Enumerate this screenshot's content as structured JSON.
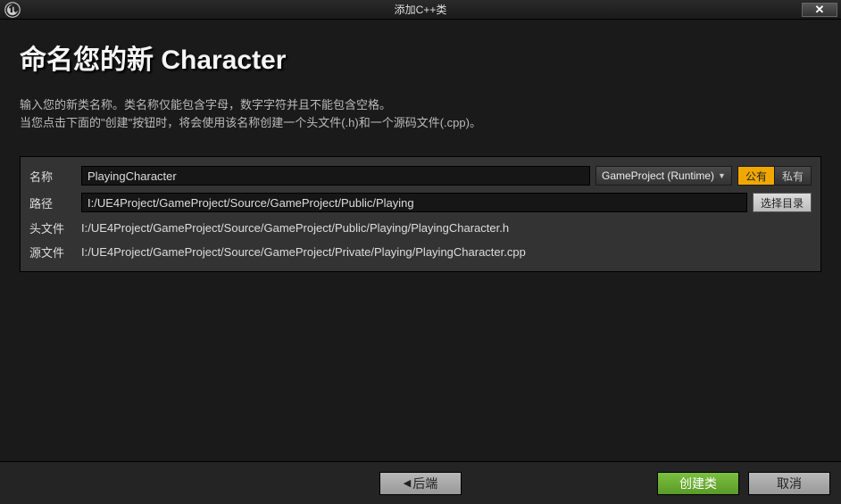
{
  "titlebar": {
    "title": "添加C++类"
  },
  "heading": {
    "prefix": "命名您的新 ",
    "class_name": "Character"
  },
  "description": {
    "line1": "输入您的新类名称。类名称仅能包含字母，数字字符并且不能包含空格。",
    "line2": "当您点击下面的\"创建\"按钮时，将会使用该名称创建一个头文件(.h)和一个源码文件(.cpp)。"
  },
  "form": {
    "name_label": "名称",
    "name_value": "PlayingCharacter",
    "module_dropdown": "GameProject (Runtime)",
    "public_label": "公有",
    "private_label": "私有",
    "path_label": "路径",
    "path_value": "I:/UE4Project/GameProject/Source/GameProject/Public/Playing",
    "browse_label": "选择目录",
    "header_label": "头文件",
    "header_value": "I:/UE4Project/GameProject/Source/GameProject/Public/Playing/PlayingCharacter.h",
    "source_label": "源文件",
    "source_value": "I:/UE4Project/GameProject/Source/GameProject/Private/Playing/PlayingCharacter.cpp"
  },
  "footer": {
    "back_label": "后端",
    "create_label": "创建类",
    "cancel_label": "取消"
  }
}
